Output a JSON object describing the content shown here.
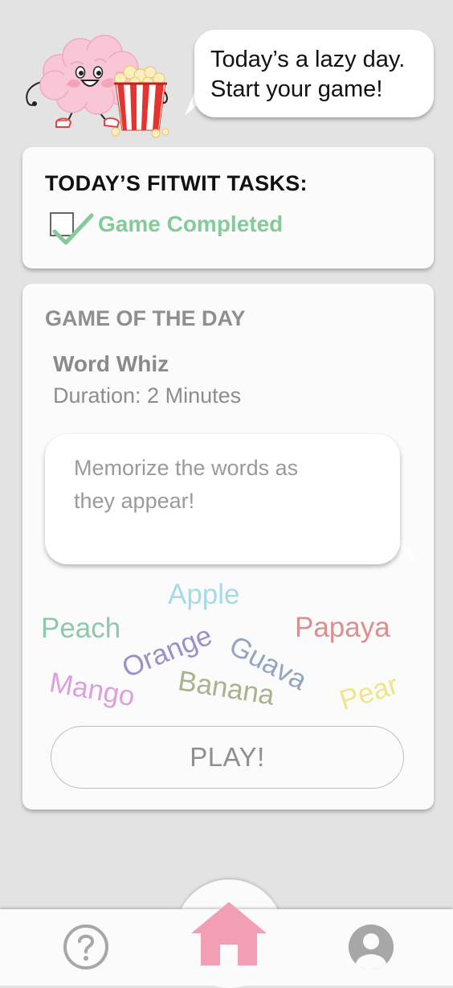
{
  "header": {
    "speech": [
      "Today’s a lazy day.",
      "Start your game!"
    ]
  },
  "tasks": {
    "title": "TODAY’S FITWIT TASKS:",
    "items": [
      {
        "label": "Game Completed",
        "checked": true
      }
    ]
  },
  "game": {
    "heading": "GAME OF THE DAY",
    "name": "Word Whiz",
    "duration": "Duration: 2 Minutes",
    "instructions": [
      "Memorize the words as",
      "they appear!"
    ],
    "words": [
      {
        "text": "Apple",
        "color": "#a6dbe6"
      },
      {
        "text": "Peach",
        "color": "#8ec8ab"
      },
      {
        "text": "Orange",
        "color": "#9c90c8"
      },
      {
        "text": "Guava",
        "color": "#94a5c2"
      },
      {
        "text": "Papaya",
        "color": "#dc8f8f"
      },
      {
        "text": "Mango",
        "color": "#dba0dd"
      },
      {
        "text": "Banana",
        "color": "#a7b48e"
      },
      {
        "text": "Pear",
        "color": "#eee68a"
      }
    ],
    "play_label": "PLAY!"
  },
  "nav": {
    "help_icon": "question-mark-circle",
    "home_icon": "house",
    "profile_icon": "user-circle",
    "active": "home"
  },
  "colors": {
    "accent_pink": "#f29fb6",
    "success_green": "#83cb98",
    "background": "#e4e3e4",
    "card": "#fcfbfc"
  }
}
